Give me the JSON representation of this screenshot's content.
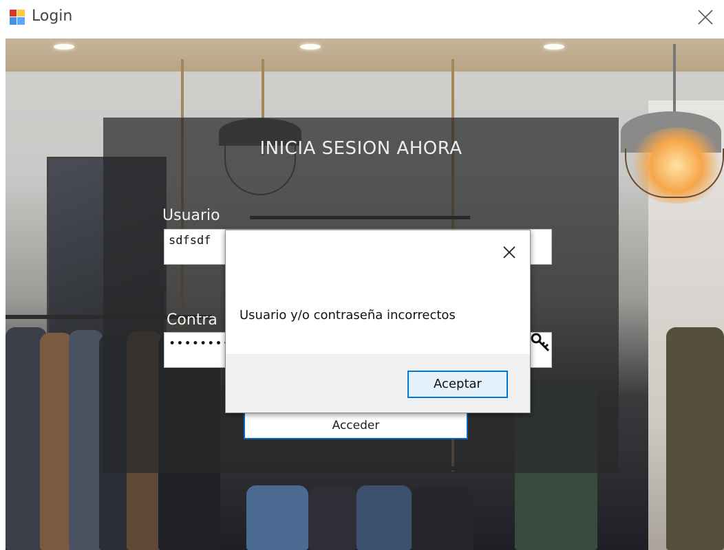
{
  "window": {
    "title": "Login",
    "icon": "app-window-icon",
    "close_icon": "close-icon"
  },
  "login_panel": {
    "heading": "INICIA SESION AHORA",
    "username_label": "Usuario",
    "username_value": "sdfsdf",
    "password_label": "Contra",
    "password_value": "••••••••",
    "password_icon": "key-icon",
    "submit_label": "Acceder"
  },
  "message_box": {
    "message": "Usuario y/o contraseña incorrectos",
    "ok_label": "Aceptar",
    "close_icon": "close-icon"
  },
  "colors": {
    "accent": "#0078d7",
    "panel_overlay": "#28282a"
  }
}
